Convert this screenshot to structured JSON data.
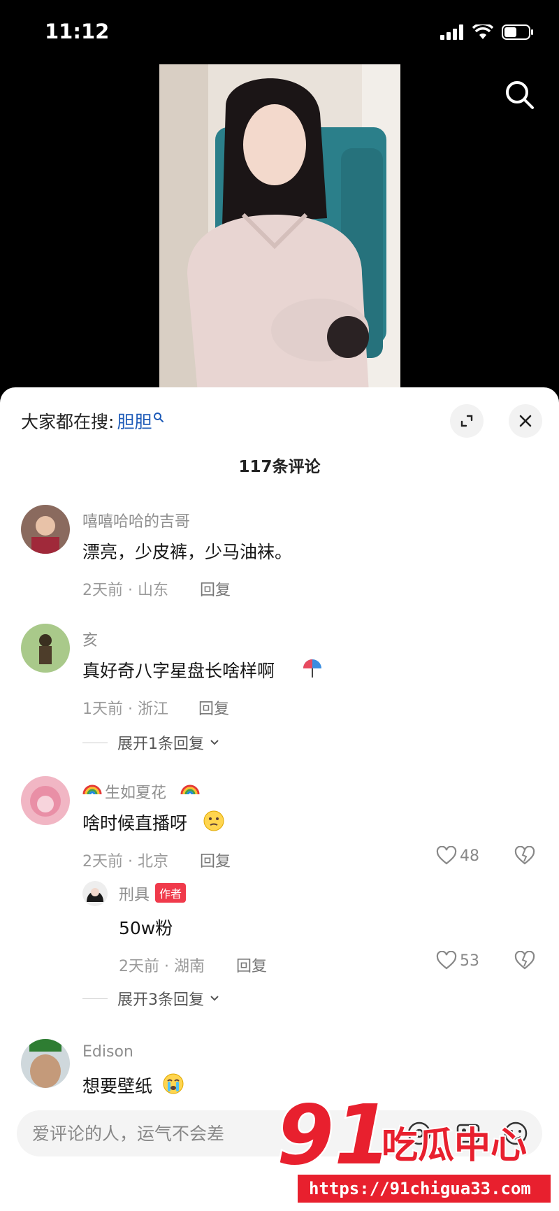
{
  "status": {
    "time": "11:12"
  },
  "sheet": {
    "hot_search_label": "大家都在搜:",
    "hot_search_keyword": "胆胆",
    "comment_count": "117条评论"
  },
  "comments": [
    {
      "user": "嘻嘻哈哈的吉哥",
      "text": "漂亮，少皮裤，少马油袜。",
      "time": "2天前 · 山东",
      "reply": "回复"
    },
    {
      "user": "亥",
      "text": "真好奇八字星盘长啥样啊",
      "time": "1天前 · 浙江",
      "reply": "回复",
      "expand": "展开1条回复"
    },
    {
      "user": "生如夏花",
      "text": "啥时候直播呀",
      "time": "2天前 · 北京",
      "reply": "回复",
      "likes": "48"
    },
    {
      "user": "刑具",
      "badge": "作者",
      "text": "50w粉",
      "time": "2天前 · 湖南",
      "reply": "回复",
      "likes": "53",
      "expand": "展开3条回复"
    },
    {
      "user": "Edison",
      "text": "想要壁纸"
    }
  ],
  "input": {
    "placeholder": "爱评论的人，运气不会差"
  },
  "watermark": {
    "brand_number": "91",
    "brand_text": "吃瓜中心",
    "url": "https://91chigua33.com"
  },
  "colors": {
    "keyword": "#1e5bb8",
    "author_badge": "#f03a4b",
    "watermark": "#e8202e"
  }
}
